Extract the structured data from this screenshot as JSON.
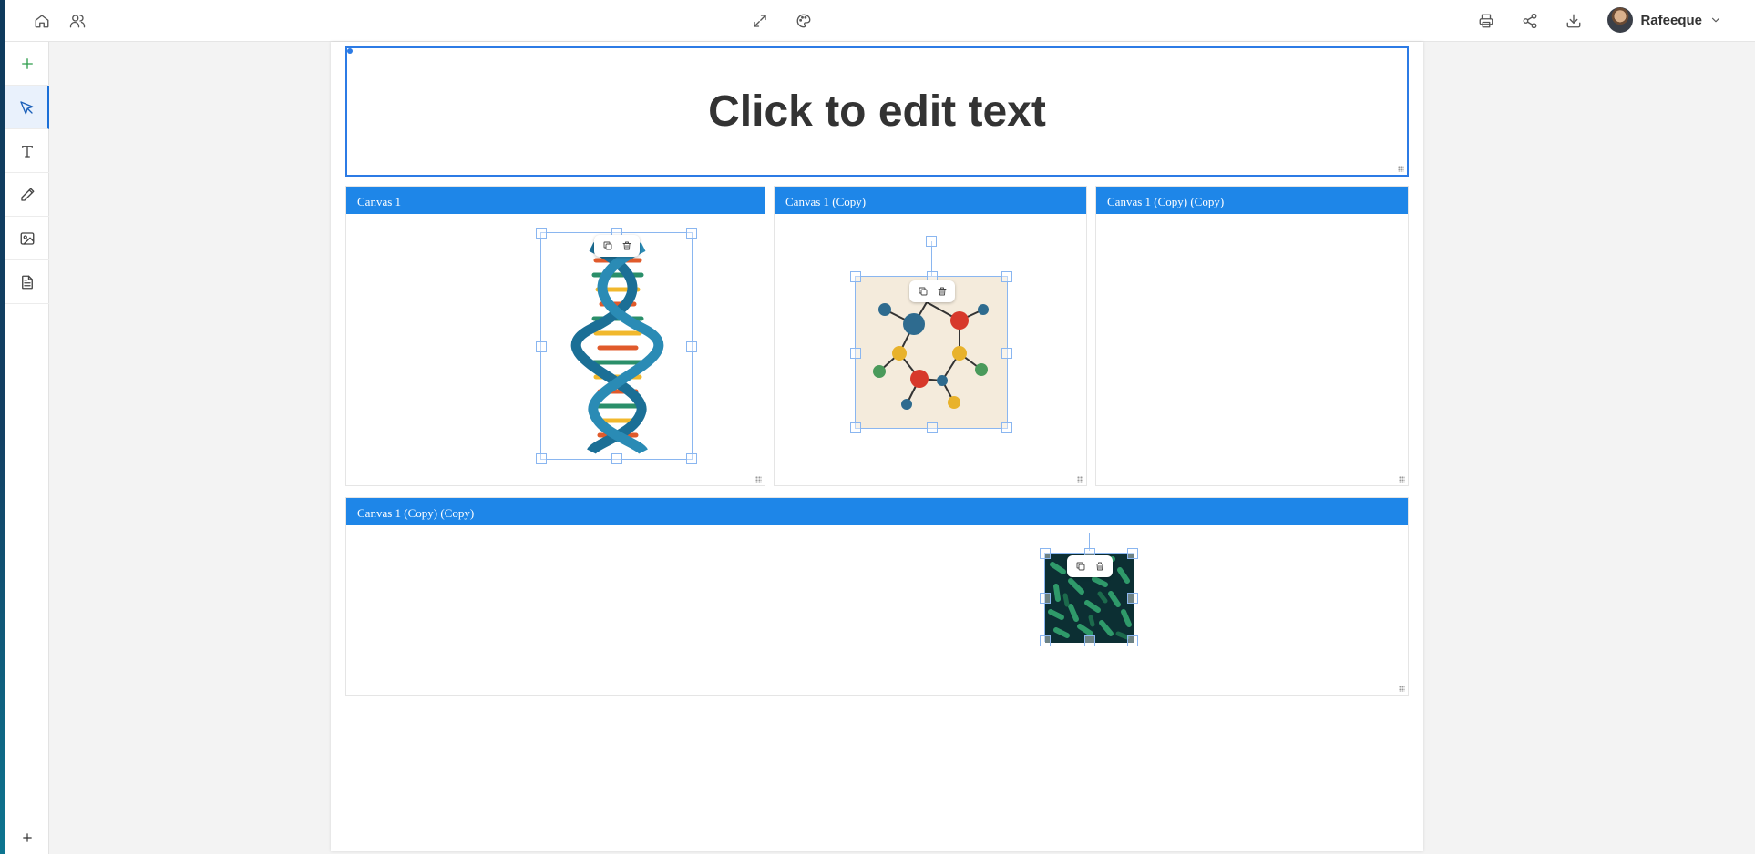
{
  "topbar": {
    "left_icons": [
      "home-icon",
      "users-icon"
    ],
    "center_icons": [
      "expand-icon",
      "palette-icon"
    ],
    "right_icons": [
      "print-icon",
      "share-icon",
      "download-icon"
    ],
    "user": {
      "name": "Rafeeque"
    }
  },
  "sidebar": {
    "tools": [
      {
        "name": "add",
        "icon": "plus-icon"
      },
      {
        "name": "select",
        "icon": "cursor-arrow-icon",
        "active": true
      },
      {
        "name": "text",
        "icon": "text-icon"
      },
      {
        "name": "draw",
        "icon": "pencil-icon"
      },
      {
        "name": "image",
        "icon": "image-icon"
      },
      {
        "name": "document",
        "icon": "document-icon"
      }
    ],
    "bottom_icon": "plus-icon"
  },
  "page": {
    "title_text": "Click to edit text",
    "canvases": [
      {
        "title": "Canvas 1",
        "image": "dna-helix"
      },
      {
        "title": "Canvas 1 (Copy)",
        "image": "molecule"
      },
      {
        "title": "Canvas 1 (Copy) (Copy)",
        "image": ""
      },
      {
        "title": "Canvas 1 (Copy) (Copy)",
        "image": "bacteria"
      }
    ]
  },
  "colors": {
    "accent": "#1e86e8",
    "selection": "#2c7be5",
    "add_green": "#2e9d4c"
  }
}
